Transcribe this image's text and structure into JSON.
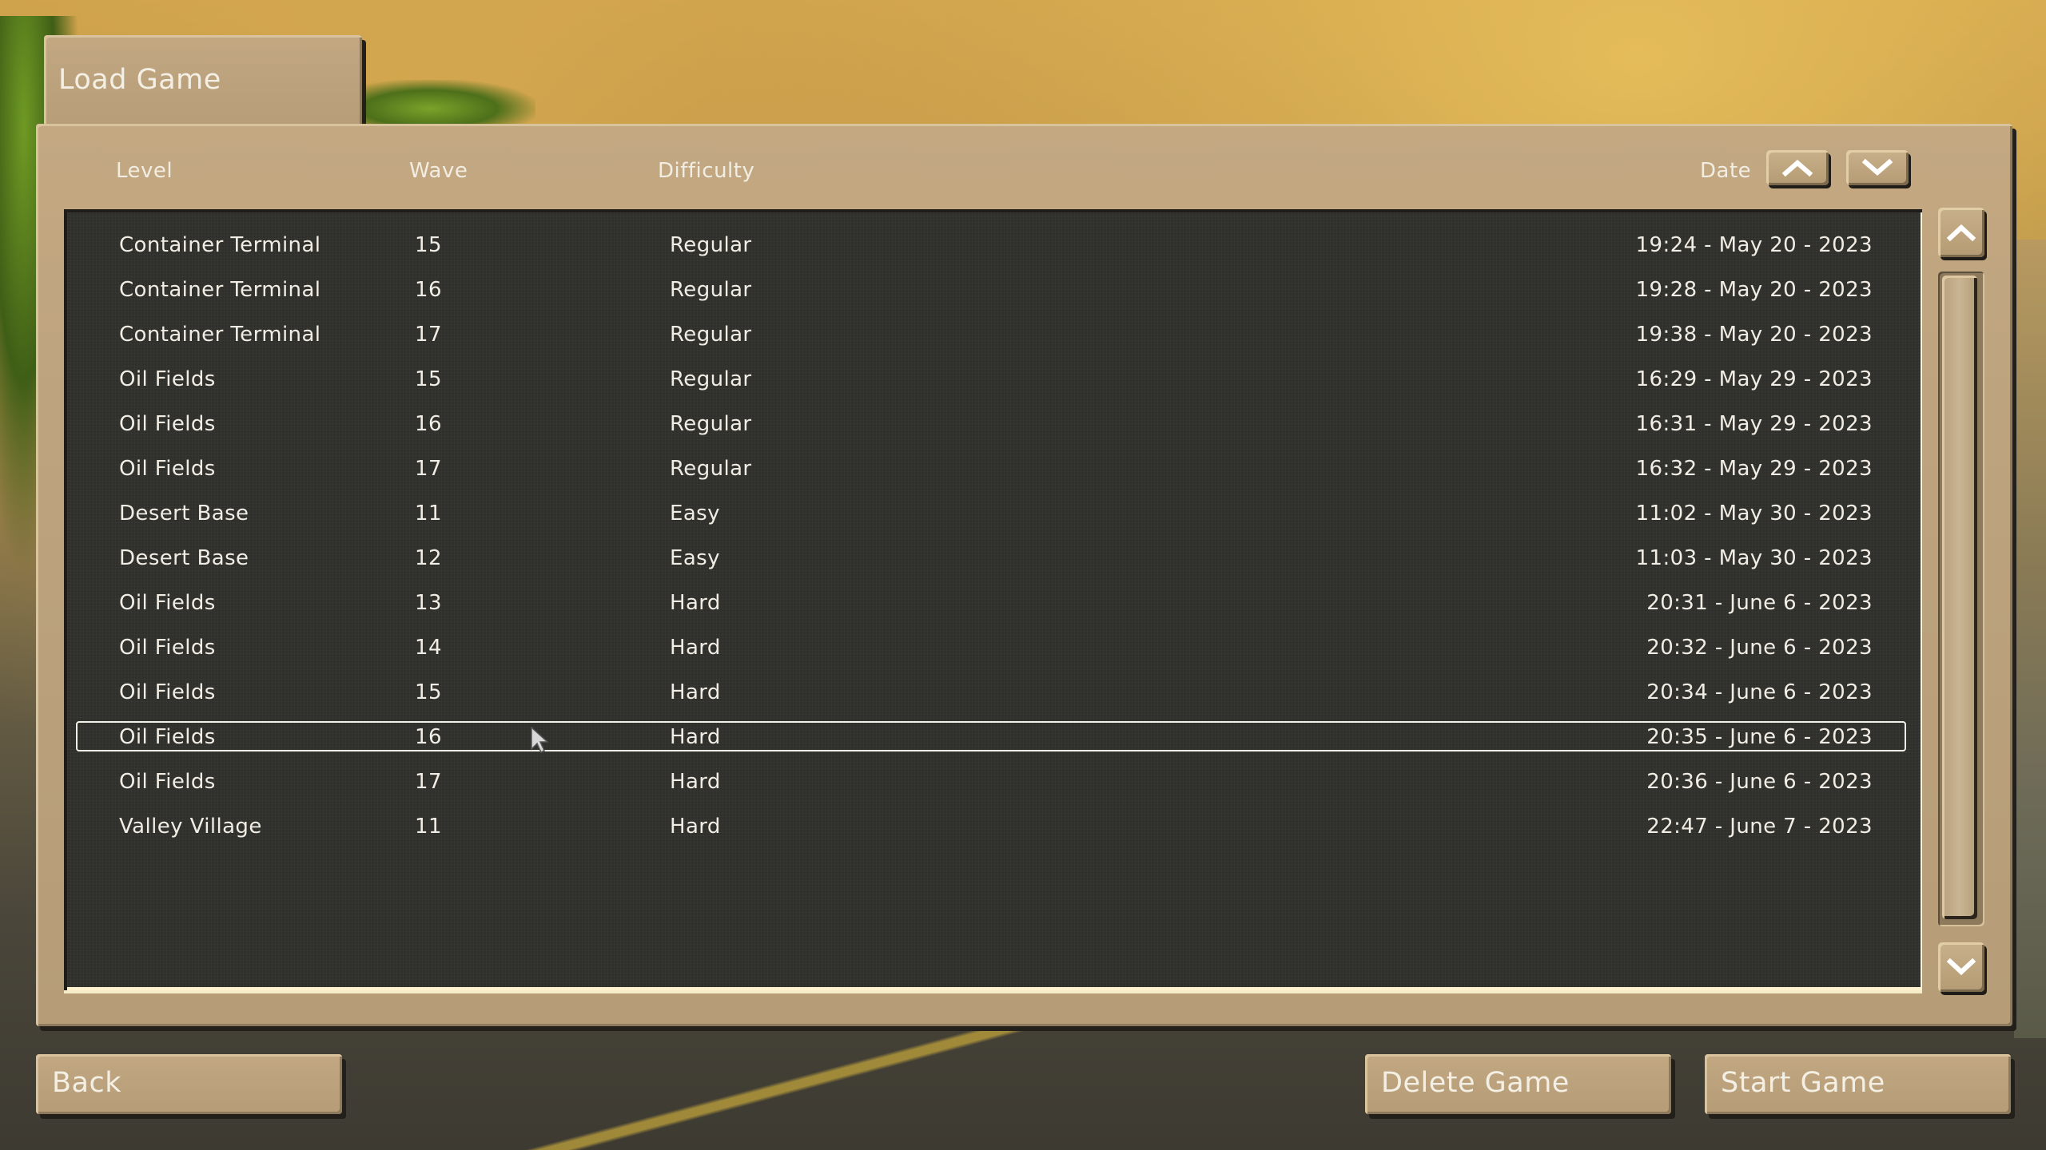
{
  "window": {
    "title": "Load Game"
  },
  "columns": {
    "level": "Level",
    "wave": "Wave",
    "difficulty": "Difficulty",
    "date": "Date"
  },
  "sort_controls": {
    "ascending_icon": "chevron-up-icon",
    "descending_icon": "chevron-down-icon"
  },
  "saves": [
    {
      "level": "Container Terminal",
      "wave": "15",
      "difficulty": "Regular",
      "date": "19:24 - May 20 - 2023"
    },
    {
      "level": "Container Terminal",
      "wave": "16",
      "difficulty": "Regular",
      "date": "19:28 - May 20 - 2023"
    },
    {
      "level": "Container Terminal",
      "wave": "17",
      "difficulty": "Regular",
      "date": "19:38 - May 20 - 2023"
    },
    {
      "level": "Oil Fields",
      "wave": "15",
      "difficulty": "Regular",
      "date": "16:29 - May 29 - 2023"
    },
    {
      "level": "Oil Fields",
      "wave": "16",
      "difficulty": "Regular",
      "date": "16:31 - May 29 - 2023"
    },
    {
      "level": "Oil Fields",
      "wave": "17",
      "difficulty": "Regular",
      "date": "16:32 - May 29 - 2023"
    },
    {
      "level": "Desert Base",
      "wave": "11",
      "difficulty": "Easy",
      "date": "11:02 - May 30 - 2023"
    },
    {
      "level": "Desert Base",
      "wave": "12",
      "difficulty": "Easy",
      "date": "11:03 - May 30 - 2023"
    },
    {
      "level": "Oil Fields",
      "wave": "13",
      "difficulty": "Hard",
      "date": "20:31 - June 6 - 2023"
    },
    {
      "level": "Oil Fields",
      "wave": "14",
      "difficulty": "Hard",
      "date": "20:32 - June 6 - 2023"
    },
    {
      "level": "Oil Fields",
      "wave": "15",
      "difficulty": "Hard",
      "date": "20:34 - June 6 - 2023"
    },
    {
      "level": "Oil Fields",
      "wave": "16",
      "difficulty": "Hard",
      "date": "20:35 - June 6 - 2023"
    },
    {
      "level": "Oil Fields",
      "wave": "17",
      "difficulty": "Hard",
      "date": "20:36 - June 6 - 2023"
    },
    {
      "level": "Valley Village",
      "wave": "11",
      "difficulty": "Hard",
      "date": "22:47 - June 7 - 2023"
    }
  ],
  "selected_index": 11,
  "scrollbar": {
    "visible_fraction": 1.0,
    "scroll_position": 0.0
  },
  "buttons": {
    "back": "Back",
    "delete": "Delete Game",
    "start": "Start Game"
  },
  "colors": {
    "panel_tan": "#bba27c",
    "list_background": "#2f302b",
    "text": "#f1ede4",
    "selection_outline": "#f4f1e8"
  }
}
